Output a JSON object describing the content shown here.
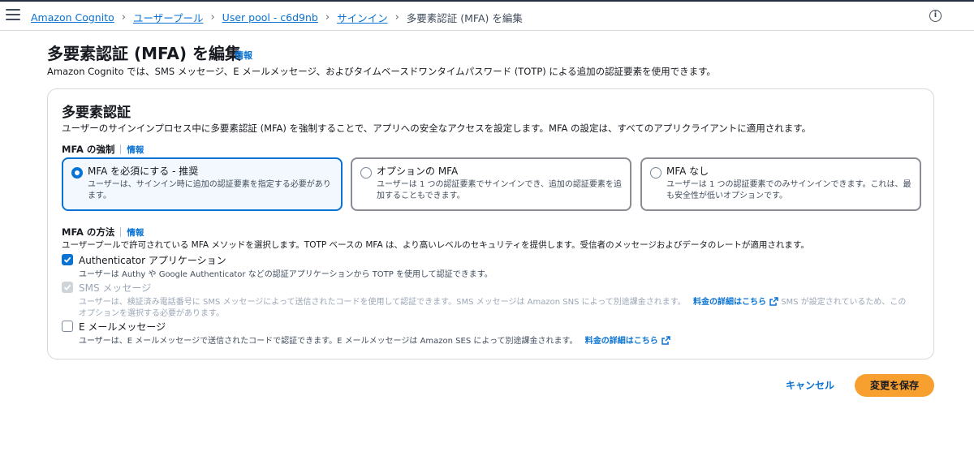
{
  "breadcrumb": {
    "items": [
      "Amazon Cognito",
      "ユーザープール",
      "User pool - c6d9nb",
      "サインイン"
    ],
    "current": "多要素認証 (MFA) を編集"
  },
  "header": {
    "title": "多要素認証 (MFA) を編集",
    "info": "情報",
    "description": "Amazon Cognito では、SMS メッセージ、E メールメッセージ、およびタイムベースドワンタイムパスワード (TOTP) による追加の認証要素を使用できます。"
  },
  "panel": {
    "title": "多要素認証",
    "description": "ユーザーのサインインプロセス中に多要素認証 (MFA) を強制することで、アプリへの安全なアクセスを設定します。MFA の設定は、すべてのアプリクライアントに適用されます。",
    "enforcement": {
      "label": "MFA の強制",
      "info": "情報",
      "options": [
        {
          "title": "MFA を必須にする - 推奨",
          "desc": "ユーザーは、サインイン時に追加の認証要素を指定する必要があります。",
          "selected": true
        },
        {
          "title": "オプションの MFA",
          "desc": "ユーザーは 1 つの認証要素でサインインでき、追加の認証要素を追加することもできます。",
          "selected": false
        },
        {
          "title": "MFA なし",
          "desc": "ユーザーは 1 つの認証要素でのみサインインできます。これは、最も安全性が低いオプションです。",
          "selected": false
        }
      ]
    },
    "methods": {
      "label": "MFA の方法",
      "info": "情報",
      "description": "ユーザープールで許可されている MFA メソッドを選択します。TOTP ベースの MFA は、より高いレベルのセキュリティを提供します。受信者のメッセージおよびデータのレートが適用されます。",
      "authenticator": {
        "label": "Authenticator アプリケーション",
        "desc": "ユーザーは Authy や Google Authenticator などの認証アプリケーションから TOTP を使用して認証できます。",
        "checked": true
      },
      "sms": {
        "label": "SMS メッセージ",
        "desc": "ユーザーは、検証済み電話番号に SMS メッセージによって送信されたコードを使用して認証できます。SMS メッセージは Amazon SNS によって別途課金されます。",
        "link": "料金の詳細はこちら",
        "note_1": "SMS が設定されているため、この",
        "note_2": "オプションを選択する必要があります。",
        "checked": true,
        "disabled": true
      },
      "email": {
        "label": "E メールメッセージ",
        "desc": "ユーザーは、E メールメッセージで送信されたコードで認証できます。E メールメッセージは Amazon SES によって別途課金されます。",
        "link": "料金の詳細はこちら",
        "checked": false
      }
    }
  },
  "footer": {
    "cancel": "キャンセル",
    "save": "変更を保存"
  },
  "colors": {
    "accent": "#0972d3",
    "primary_button": "#f79f2f"
  }
}
